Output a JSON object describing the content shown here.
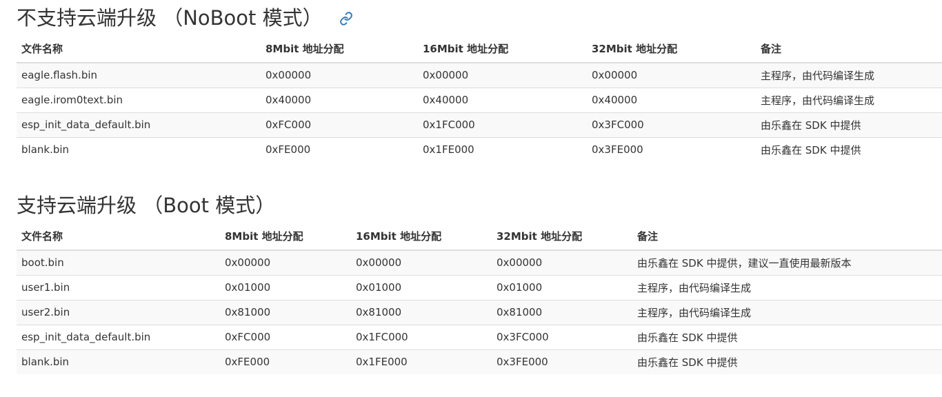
{
  "sections": [
    {
      "title": "不支持云端升级 （NoBoot 模式）",
      "link_icon": "link-icon",
      "headers": [
        "文件名称",
        "8Mbit 地址分配",
        "16Mbit 地址分配",
        "32Mbit 地址分配",
        "备注"
      ],
      "rows": [
        [
          "eagle.flash.bin",
          "0x00000",
          "0x00000",
          "0x00000",
          "主程序，由代码编译生成"
        ],
        [
          "eagle.irom0text.bin",
          "0x40000",
          "0x40000",
          "0x40000",
          "主程序，由代码编译生成"
        ],
        [
          "esp_init_data_default.bin",
          "0xFC000",
          "0x1FC000",
          "0x3FC000",
          "由乐鑫在 SDK 中提供"
        ],
        [
          "blank.bin",
          "0xFE000",
          "0x1FE000",
          "0x3FE000",
          "由乐鑫在 SDK 中提供"
        ]
      ]
    },
    {
      "title": "支持云端升级 （Boot 模式）",
      "headers": [
        "文件名称",
        "8Mbit 地址分配",
        "16Mbit 地址分配",
        "32Mbit 地址分配",
        "备注"
      ],
      "rows": [
        [
          "boot.bin",
          "0x00000",
          "0x00000",
          "0x00000",
          "由乐鑫在 SDK 中提供，建议一直使用最新版本"
        ],
        [
          "user1.bin",
          "0x01000",
          "0x01000",
          "0x01000",
          "主程序，由代码编译生成"
        ],
        [
          "user2.bin",
          "0x81000",
          "0x81000",
          "0x81000",
          "主程序，由代码编译生成"
        ],
        [
          "esp_init_data_default.bin",
          "0xFC000",
          "0x1FC000",
          "0x3FC000",
          "由乐鑫在 SDK 中提供"
        ],
        [
          "blank.bin",
          "0xFE000",
          "0x1FE000",
          "0x3FE000",
          "由乐鑫在 SDK 中提供"
        ]
      ]
    }
  ],
  "colors": {
    "text": "#333333",
    "link": "#337ab7",
    "stripe": "#f9f9f9",
    "border": "#dddddd"
  }
}
